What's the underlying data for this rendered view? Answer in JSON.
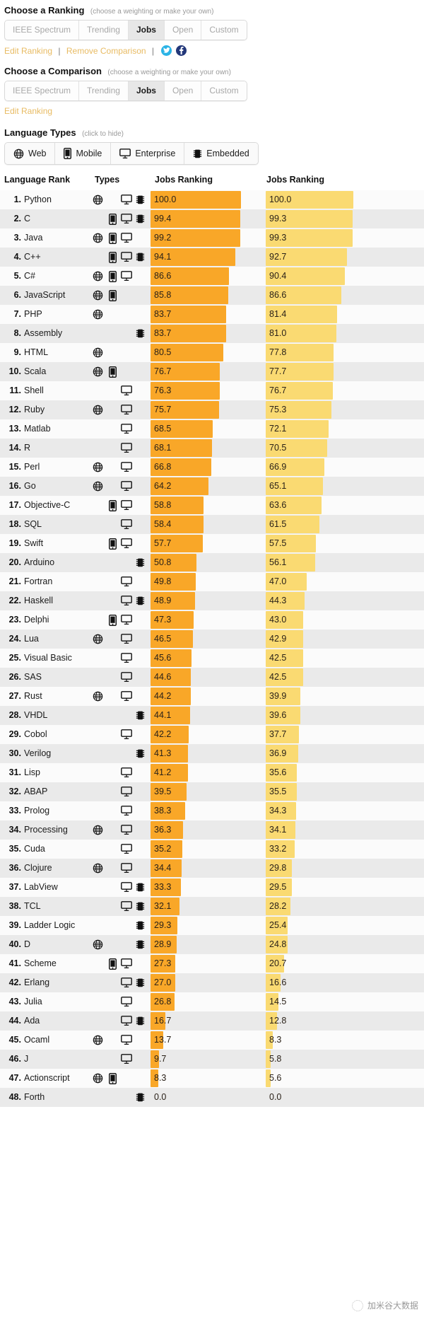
{
  "ranking_section": {
    "title": "Choose a Ranking",
    "note": "(choose a weighting or make your own)",
    "tabs": [
      {
        "label": "IEEE Spectrum",
        "active": false
      },
      {
        "label": "Trending",
        "active": false
      },
      {
        "label": "Jobs",
        "active": true
      },
      {
        "label": "Open",
        "active": false
      },
      {
        "label": "Custom",
        "active": false
      }
    ],
    "links": [
      {
        "label": "Edit Ranking"
      },
      {
        "label": "Remove Comparison"
      }
    ],
    "separator": "|",
    "social": [
      {
        "name": "twitter",
        "color": "#2ab3e6"
      },
      {
        "name": "facebook",
        "color": "#23387a"
      }
    ]
  },
  "comparison_section": {
    "title": "Choose a Comparison",
    "note": "(choose a weighting or make your own)",
    "tabs": [
      {
        "label": "IEEE Spectrum",
        "active": false
      },
      {
        "label": "Trending",
        "active": false
      },
      {
        "label": "Jobs",
        "active": true
      },
      {
        "label": "Open",
        "active": false
      },
      {
        "label": "Custom",
        "active": false
      }
    ],
    "links": [
      {
        "label": "Edit Ranking"
      }
    ]
  },
  "types_section": {
    "title": "Language Types",
    "note": "(click to hide)",
    "filters": [
      {
        "label": "Web",
        "icon": "globe-icon"
      },
      {
        "label": "Mobile",
        "icon": "phone-icon"
      },
      {
        "label": "Enterprise",
        "icon": "desktop-icon"
      },
      {
        "label": "Embedded",
        "icon": "chip-icon"
      }
    ]
  },
  "table": {
    "headers": {
      "rank": "Language Rank",
      "types": "Types",
      "ranking_left": "Jobs Ranking",
      "ranking_right": "Jobs Ranking"
    },
    "colors": {
      "bar_left": "#f9a728",
      "bar_right": "#fada72",
      "row_even": "#fbfbfb",
      "row_odd": "#eaeaea",
      "link_line": "#8a5a5a"
    }
  },
  "watermark": {
    "text": "加米谷大数据"
  },
  "chart_data": {
    "type": "bar",
    "title": "Jobs Ranking",
    "xlabel": "",
    "ylabel": "Language Rank",
    "xlim": [
      0,
      100
    ],
    "grid": false,
    "legend": "none",
    "categories": [
      "Python",
      "C",
      "Java",
      "C++",
      "C#",
      "JavaScript",
      "PHP",
      "Assembly",
      "HTML",
      "Scala",
      "Shell",
      "Ruby",
      "Matlab",
      "R",
      "Perl",
      "Go",
      "Objective-C",
      "SQL",
      "Swift",
      "Arduino",
      "Fortran",
      "Haskell",
      "Delphi",
      "Lua",
      "Visual Basic",
      "SAS",
      "Rust",
      "VHDL",
      "Cobol",
      "Verilog",
      "Lisp",
      "ABAP",
      "Prolog",
      "Processing",
      "Cuda",
      "Clojure",
      "LabView",
      "TCL",
      "Ladder Logic",
      "D",
      "Scheme",
      "Erlang",
      "Julia",
      "Ada",
      "Ocaml",
      "J",
      "Actionscript",
      "Forth"
    ],
    "series": [
      {
        "name": "Jobs Ranking",
        "values": [
          100.0,
          99.4,
          99.2,
          94.1,
          86.6,
          85.8,
          83.7,
          83.7,
          80.5,
          76.7,
          76.3,
          75.7,
          68.5,
          68.1,
          66.8,
          64.2,
          58.8,
          58.4,
          57.7,
          50.8,
          49.8,
          48.9,
          47.3,
          46.5,
          45.6,
          44.6,
          44.2,
          44.1,
          42.2,
          41.3,
          41.2,
          39.5,
          38.3,
          36.3,
          35.2,
          34.4,
          33.3,
          32.1,
          29.3,
          28.9,
          27.3,
          27.0,
          26.8,
          16.7,
          13.7,
          9.7,
          8.3,
          0.0
        ]
      },
      {
        "name": "Jobs Ranking (comparison)",
        "values": [
          100.0,
          99.3,
          99.3,
          92.7,
          90.4,
          86.6,
          81.4,
          81.0,
          77.8,
          77.7,
          76.7,
          75.3,
          72.1,
          70.5,
          66.9,
          65.1,
          63.6,
          61.5,
          57.5,
          56.1,
          47.0,
          44.3,
          43.0,
          42.9,
          42.5,
          42.5,
          39.9,
          39.6,
          37.7,
          36.9,
          35.6,
          35.5,
          34.3,
          34.1,
          33.2,
          29.8,
          29.5,
          28.2,
          25.4,
          24.8,
          20.7,
          16.6,
          14.5,
          12.8,
          8.3,
          5.8,
          5.6,
          0.0
        ]
      }
    ],
    "rows": [
      {
        "rank": 1,
        "name": "Python",
        "types": [
          "web",
          "ent",
          "emb"
        ],
        "left": "100.0",
        "right": "100.0"
      },
      {
        "rank": 2,
        "name": "C",
        "types": [
          "mob",
          "ent",
          "emb"
        ],
        "left": "99.4",
        "right": "99.3"
      },
      {
        "rank": 3,
        "name": "Java",
        "types": [
          "web",
          "mob",
          "ent"
        ],
        "left": "99.2",
        "right": "99.3"
      },
      {
        "rank": 4,
        "name": "C++",
        "types": [
          "mob",
          "ent",
          "emb"
        ],
        "left": "94.1",
        "right": "92.7"
      },
      {
        "rank": 5,
        "name": "C#",
        "types": [
          "web",
          "mob",
          "ent"
        ],
        "left": "86.6",
        "right": "90.4"
      },
      {
        "rank": 6,
        "name": "JavaScript",
        "types": [
          "web",
          "mob"
        ],
        "left": "85.8",
        "right": "86.6"
      },
      {
        "rank": 7,
        "name": "PHP",
        "types": [
          "web"
        ],
        "left": "83.7",
        "right": "81.4"
      },
      {
        "rank": 8,
        "name": "Assembly",
        "types": [
          "emb"
        ],
        "left": "83.7",
        "right": "81.0"
      },
      {
        "rank": 9,
        "name": "HTML",
        "types": [
          "web"
        ],
        "left": "80.5",
        "right": "77.8"
      },
      {
        "rank": 10,
        "name": "Scala",
        "types": [
          "web",
          "mob"
        ],
        "left": "76.7",
        "right": "77.7"
      },
      {
        "rank": 11,
        "name": "Shell",
        "types": [
          "ent"
        ],
        "left": "76.3",
        "right": "76.7"
      },
      {
        "rank": 12,
        "name": "Ruby",
        "types": [
          "web",
          "ent"
        ],
        "left": "75.7",
        "right": "75.3"
      },
      {
        "rank": 13,
        "name": "Matlab",
        "types": [
          "ent"
        ],
        "left": "68.5",
        "right": "72.1"
      },
      {
        "rank": 14,
        "name": "R",
        "types": [
          "ent"
        ],
        "left": "68.1",
        "right": "70.5"
      },
      {
        "rank": 15,
        "name": "Perl",
        "types": [
          "web",
          "ent"
        ],
        "left": "66.8",
        "right": "66.9"
      },
      {
        "rank": 16,
        "name": "Go",
        "types": [
          "web",
          "ent"
        ],
        "left": "64.2",
        "right": "65.1"
      },
      {
        "rank": 17,
        "name": "Objective-C",
        "types": [
          "mob",
          "ent"
        ],
        "left": "58.8",
        "right": "63.6"
      },
      {
        "rank": 18,
        "name": "SQL",
        "types": [
          "ent"
        ],
        "left": "58.4",
        "right": "61.5"
      },
      {
        "rank": 19,
        "name": "Swift",
        "types": [
          "mob",
          "ent"
        ],
        "left": "57.7",
        "right": "57.5"
      },
      {
        "rank": 20,
        "name": "Arduino",
        "types": [
          "emb"
        ],
        "left": "50.8",
        "right": "56.1"
      },
      {
        "rank": 21,
        "name": "Fortran",
        "types": [
          "ent"
        ],
        "left": "49.8",
        "right": "47.0"
      },
      {
        "rank": 22,
        "name": "Haskell",
        "types": [
          "ent",
          "emb"
        ],
        "left": "48.9",
        "right": "44.3"
      },
      {
        "rank": 23,
        "name": "Delphi",
        "types": [
          "mob",
          "ent"
        ],
        "left": "47.3",
        "right": "43.0"
      },
      {
        "rank": 24,
        "name": "Lua",
        "types": [
          "web",
          "ent"
        ],
        "left": "46.5",
        "right": "42.9"
      },
      {
        "rank": 25,
        "name": "Visual Basic",
        "types": [
          "ent"
        ],
        "left": "45.6",
        "right": "42.5"
      },
      {
        "rank": 26,
        "name": "SAS",
        "types": [
          "ent"
        ],
        "left": "44.6",
        "right": "42.5"
      },
      {
        "rank": 27,
        "name": "Rust",
        "types": [
          "web",
          "ent"
        ],
        "left": "44.2",
        "right": "39.9"
      },
      {
        "rank": 28,
        "name": "VHDL",
        "types": [
          "emb"
        ],
        "left": "44.1",
        "right": "39.6"
      },
      {
        "rank": 29,
        "name": "Cobol",
        "types": [
          "ent"
        ],
        "left": "42.2",
        "right": "37.7"
      },
      {
        "rank": 30,
        "name": "Verilog",
        "types": [
          "emb"
        ],
        "left": "41.3",
        "right": "36.9"
      },
      {
        "rank": 31,
        "name": "Lisp",
        "types": [
          "ent"
        ],
        "left": "41.2",
        "right": "35.6"
      },
      {
        "rank": 32,
        "name": "ABAP",
        "types": [
          "ent"
        ],
        "left": "39.5",
        "right": "35.5"
      },
      {
        "rank": 33,
        "name": "Prolog",
        "types": [
          "ent"
        ],
        "left": "38.3",
        "right": "34.3"
      },
      {
        "rank": 34,
        "name": "Processing",
        "types": [
          "web",
          "ent"
        ],
        "left": "36.3",
        "right": "34.1"
      },
      {
        "rank": 35,
        "name": "Cuda",
        "types": [
          "ent"
        ],
        "left": "35.2",
        "right": "33.2"
      },
      {
        "rank": 36,
        "name": "Clojure",
        "types": [
          "web",
          "ent"
        ],
        "left": "34.4",
        "right": "29.8"
      },
      {
        "rank": 37,
        "name": "LabView",
        "types": [
          "ent",
          "emb"
        ],
        "left": "33.3",
        "right": "29.5"
      },
      {
        "rank": 38,
        "name": "TCL",
        "types": [
          "ent",
          "emb"
        ],
        "left": "32.1",
        "right": "28.2"
      },
      {
        "rank": 39,
        "name": "Ladder Logic",
        "types": [
          "emb"
        ],
        "left": "29.3",
        "right": "25.4"
      },
      {
        "rank": 40,
        "name": "D",
        "types": [
          "web",
          "emb"
        ],
        "left": "28.9",
        "right": "24.8"
      },
      {
        "rank": 41,
        "name": "Scheme",
        "types": [
          "mob",
          "ent"
        ],
        "left": "27.3",
        "right": "20.7"
      },
      {
        "rank": 42,
        "name": "Erlang",
        "types": [
          "ent",
          "emb"
        ],
        "left": "27.0",
        "right": "16.6"
      },
      {
        "rank": 43,
        "name": "Julia",
        "types": [
          "ent"
        ],
        "left": "26.8",
        "right": "14.5"
      },
      {
        "rank": 44,
        "name": "Ada",
        "types": [
          "ent",
          "emb"
        ],
        "left": "16.7",
        "right": "12.8"
      },
      {
        "rank": 45,
        "name": "Ocaml",
        "types": [
          "web",
          "ent"
        ],
        "left": "13.7",
        "right": "8.3"
      },
      {
        "rank": 46,
        "name": "J",
        "types": [
          "ent"
        ],
        "left": "9.7",
        "right": "5.8"
      },
      {
        "rank": 47,
        "name": "Actionscript",
        "types": [
          "web",
          "mob"
        ],
        "left": "8.3",
        "right": "5.6"
      },
      {
        "rank": 48,
        "name": "Forth",
        "types": [
          "emb"
        ],
        "left": "0.0",
        "right": "0.0"
      }
    ]
  }
}
